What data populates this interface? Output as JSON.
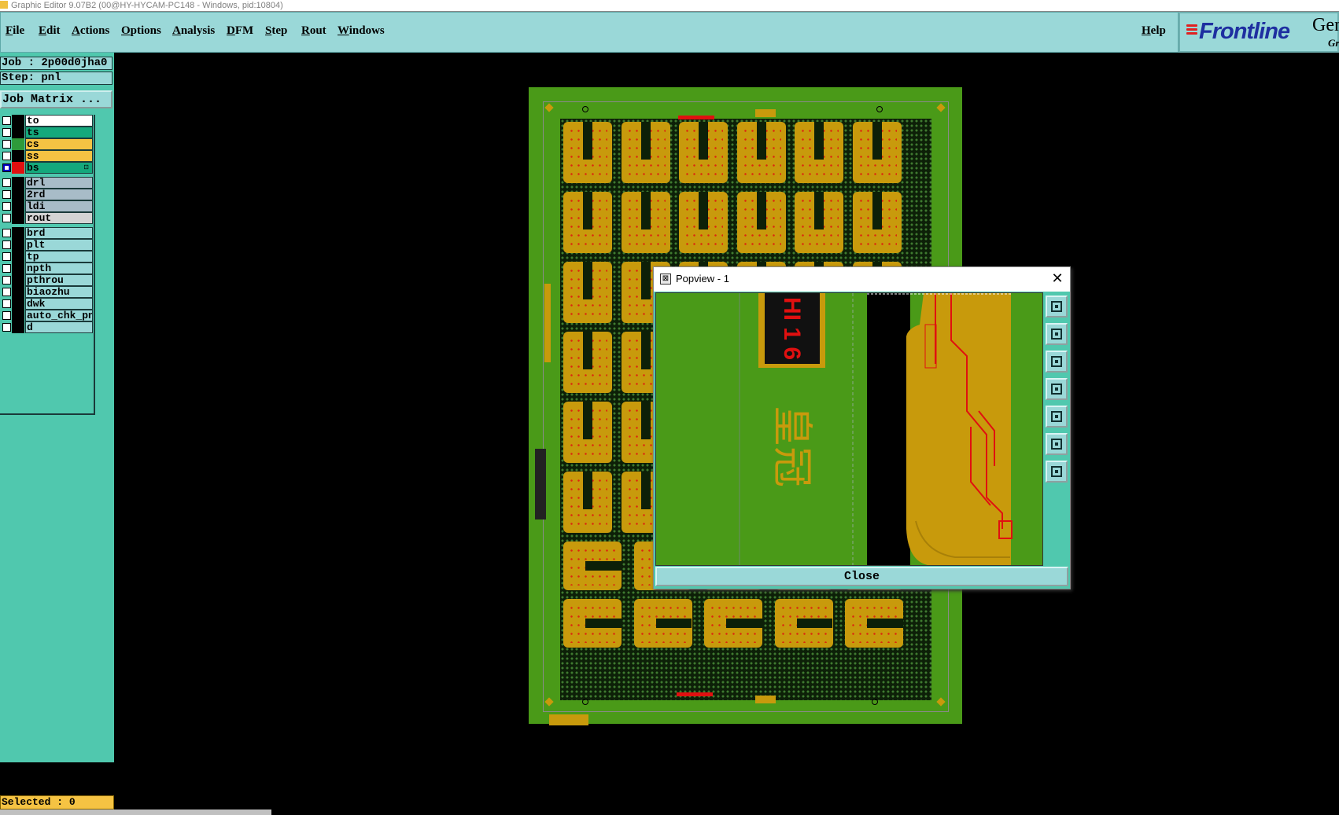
{
  "window": {
    "title": "Graphic Editor 9.07B2 (00@HY-HYCAM-PC148 - Windows, pid:10804)"
  },
  "menu": {
    "items": [
      "File",
      "Edit",
      "Actions",
      "Options",
      "Analysis",
      "DFM",
      "Step",
      "Rout",
      "Windows"
    ],
    "help": "Help"
  },
  "logo": {
    "brand": "Frontline",
    "product": "Gen",
    "sub": "Gr"
  },
  "job": {
    "job_label": "Job : 2p00d0jha0",
    "step_label": "Step: pnl",
    "matrix_button": "Job Matrix ..."
  },
  "layers": [
    {
      "name": "to",
      "color": "#ffffff",
      "swatch": "#000000"
    },
    {
      "name": "ts",
      "color": "#14a87c",
      "swatch": "#000000"
    },
    {
      "name": "cs",
      "color": "#f5c343",
      "swatch": "#2e9a3a"
    },
    {
      "name": "ss",
      "color": "#f5c343",
      "swatch": "#000000"
    },
    {
      "name": "bs",
      "color": "#14a87c",
      "swatch": "#e01010",
      "mark": "⊡"
    },
    {
      "name": "drl",
      "color": "#a8bcc8",
      "swatch": "#000000"
    },
    {
      "name": "2rd",
      "color": "#a8bcc8",
      "swatch": "#000000"
    },
    {
      "name": "ldi",
      "color": "#a8bcc8",
      "swatch": "#000000"
    },
    {
      "name": "rout",
      "color": "#d4d4d4",
      "swatch": "#000000"
    },
    {
      "name": "brd",
      "color": "#9ad8d8",
      "swatch": "#000000"
    },
    {
      "name": "plt",
      "color": "#9ad8d8",
      "swatch": "#000000"
    },
    {
      "name": "tp",
      "color": "#9ad8d8",
      "swatch": "#000000"
    },
    {
      "name": "npth",
      "color": "#9ad8d8",
      "swatch": "#000000"
    },
    {
      "name": "pthrou",
      "color": "#9ad8d8",
      "swatch": "#000000"
    },
    {
      "name": "biaozhu",
      "color": "#9ad8d8",
      "swatch": "#000000"
    },
    {
      "name": "dwk",
      "color": "#9ad8d8",
      "swatch": "#000000"
    },
    {
      "name": "auto_chk_pnl",
      "color": "#9ad8d8",
      "swatch": "#000000"
    },
    {
      "name": "d",
      "color": "#9ad8d8",
      "swatch": "#000000"
    }
  ],
  "status": {
    "selected": "Selected : 0"
  },
  "popview": {
    "title": "Popview - 1",
    "close_x": "✕",
    "close_button": "Close",
    "tools": [
      "zoom-window-icon",
      "pan-up-icon",
      "pan-down-icon",
      "pan-left-icon",
      "pan-right-icon",
      "zoom-fit-icon",
      "zoom-home-icon"
    ],
    "canvas_text": {
      "box_text": "HI 1 6",
      "chinese": "皇冠"
    }
  },
  "colors": {
    "background": "#000000",
    "panel": "#50c8ae",
    "menubar": "#9ad8d8",
    "board_green": "#4a9a18",
    "copper": "#c89a0c",
    "highlight_red": "#e01010",
    "brand_blue": "#1e2fa0"
  }
}
